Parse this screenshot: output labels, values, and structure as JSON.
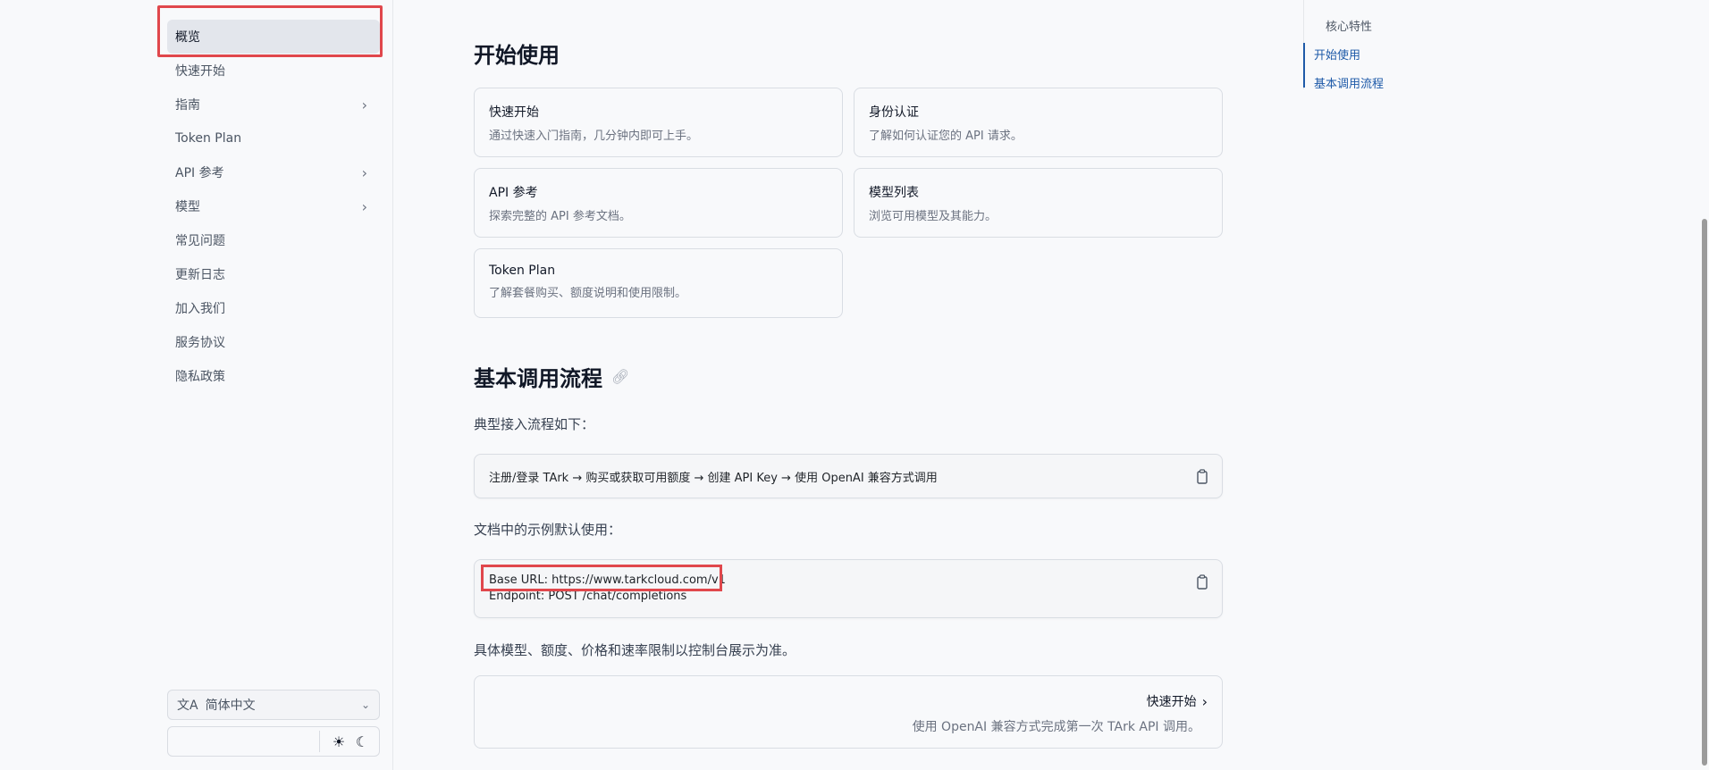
{
  "sidebar": {
    "items": [
      {
        "label": "概览",
        "chevron": false,
        "active": true
      },
      {
        "label": "快速开始",
        "chevron": false
      },
      {
        "label": "指南",
        "chevron": true
      },
      {
        "label": "Token Plan",
        "chevron": false
      },
      {
        "label": "API 参考",
        "chevron": true
      },
      {
        "label": "模型",
        "chevron": true
      },
      {
        "label": "常见问题",
        "chevron": false
      },
      {
        "label": "更新日志",
        "chevron": false
      },
      {
        "label": "加入我们",
        "chevron": false
      },
      {
        "label": "服务协议",
        "chevron": false
      },
      {
        "label": "隐私政策",
        "chevron": false
      }
    ],
    "language": "简体中文"
  },
  "main": {
    "start_heading": "开始使用",
    "cards": [
      {
        "title": "快速开始",
        "desc": "通过快速入门指南，几分钟内即可上手。"
      },
      {
        "title": "身份认证",
        "desc": "了解如何认证您的 API 请求。"
      },
      {
        "title": "API 参考",
        "desc": "探索完整的 API 参考文档。"
      },
      {
        "title": "模型列表",
        "desc": "浏览可用模型及其能力。"
      },
      {
        "title": "Token Plan",
        "desc": "了解套餐购买、额度说明和使用限制。"
      }
    ],
    "flow_heading": "基本调用流程",
    "flow_intro": "典型接入流程如下：",
    "flow_code": "注册/登录 TArk → 购买或获取可用额度 → 创建 API Key → 使用 OpenAI 兼容方式调用",
    "example_intro": "文档中的示例默认使用：",
    "example_line1": "Base URL: https://www.tarkcloud.com/v1",
    "example_line2": "Endpoint: POST /chat/completions",
    "limits_note": "具体模型、额度、价格和速率限制以控制台展示为准。",
    "next": {
      "title": "快速开始",
      "desc": "使用 OpenAI 兼容方式完成第一次 TArk API 调用。"
    }
  },
  "toc": {
    "items": [
      {
        "label": "核心特性"
      },
      {
        "label": "开始使用"
      },
      {
        "label": "基本调用流程"
      }
    ]
  },
  "colors": {
    "accent": "#1e5aa8",
    "highlight": "#e0474c"
  }
}
